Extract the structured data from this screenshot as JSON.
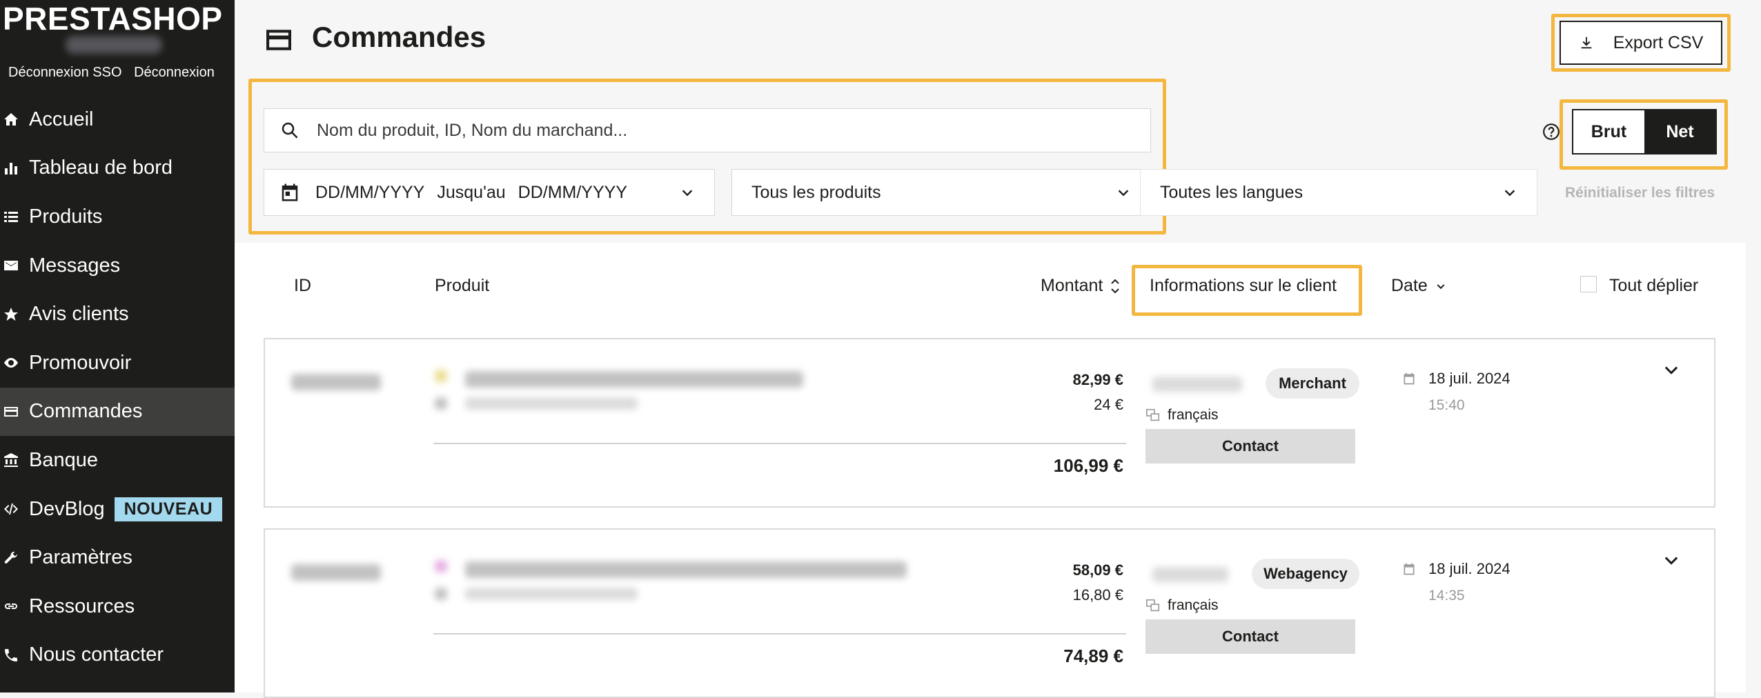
{
  "sidebar": {
    "brand": "PRESTASHOP",
    "logout_sso": "Déconnexion SSO",
    "logout": "Déconnexion",
    "items": [
      {
        "label": "Accueil",
        "icon": "home-icon"
      },
      {
        "label": "Tableau de bord",
        "icon": "bar-chart-icon"
      },
      {
        "label": "Produits",
        "icon": "list-icon"
      },
      {
        "label": "Messages",
        "icon": "envelope-icon"
      },
      {
        "label": "Avis clients",
        "icon": "star-icon"
      },
      {
        "label": "Promouvoir",
        "icon": "eye-icon"
      },
      {
        "label": "Commandes",
        "icon": "card-icon"
      },
      {
        "label": "Banque",
        "icon": "bank-icon"
      },
      {
        "label": "DevBlog",
        "icon": "code-icon",
        "badge": "NOUVEAU"
      },
      {
        "label": "Paramètres",
        "icon": "wrench-icon"
      },
      {
        "label": "Ressources",
        "icon": "link-icon"
      },
      {
        "label": "Nous contacter",
        "icon": "phone-icon"
      }
    ],
    "active": "Commandes"
  },
  "header": {
    "title": "Commandes",
    "export_label": "Export CSV"
  },
  "filters": {
    "search_placeholder": "Nom du produit, ID, Nom du marchand...",
    "date_from": "DD/MM/YYYY",
    "date_sep": "Jusqu'au",
    "date_to": "DD/MM/YYYY",
    "products": "Tous les produits",
    "languages": "Toutes les langues",
    "toggle_brut": "Brut",
    "toggle_net": "Net",
    "reset": "Réinitialiser les filtres"
  },
  "table": {
    "col_id": "ID",
    "col_product": "Produit",
    "col_amount": "Montant",
    "col_client": "Informations sur le client",
    "col_date": "Date",
    "expand_all": "Tout déplier",
    "orders": [
      {
        "amount_main": "82,99 €",
        "amount_sub": "24 €",
        "total": "106,99 €",
        "client_type": "Merchant",
        "language": "français",
        "contact": "Contact",
        "date": "18 juil. 2024",
        "time": "15:40"
      },
      {
        "amount_main": "58,09 €",
        "amount_sub": "16,80 €",
        "total": "74,89 €",
        "client_type": "Webagency",
        "language": "français",
        "contact": "Contact",
        "date": "18 juil. 2024",
        "time": "14:35"
      }
    ]
  },
  "colors": {
    "highlight": "#f3b73f",
    "sidebar": "#1d1d1b",
    "badge": "#a3d9ef"
  }
}
